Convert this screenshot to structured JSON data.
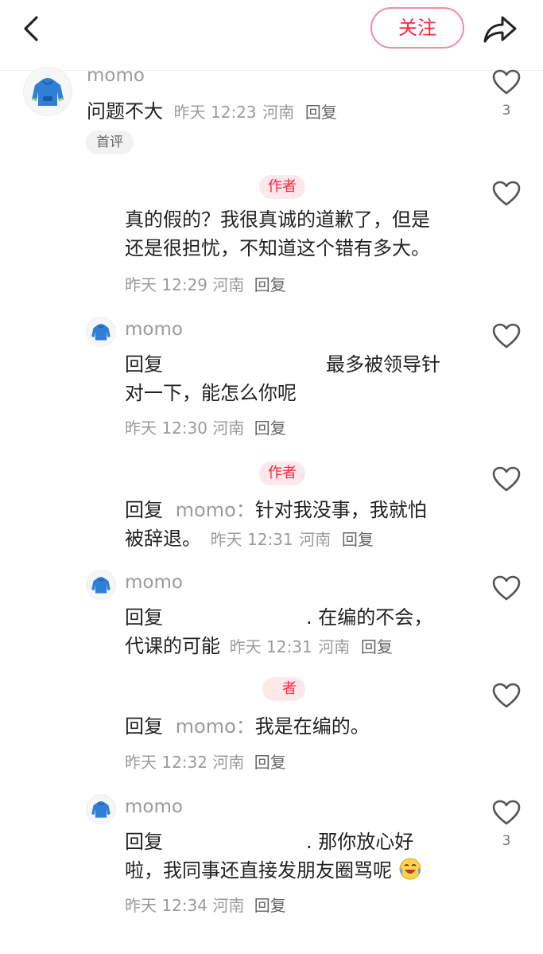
{
  "header": {
    "follow_label": "关注"
  },
  "comment": {
    "username": "momo",
    "text": "问题不大",
    "time": "昨天 12:23",
    "location": "河南",
    "reply_label": "回复",
    "first_badge": "首评",
    "like_count": "3"
  },
  "replies": [
    {
      "badge": "作者",
      "line1": "真的假的？我很真诚的道歉了，但是",
      "line2": "还是很担忧，不知道这个错有多大。",
      "time": "昨天 12:29",
      "location": "河南",
      "reply_label": "回复"
    },
    {
      "username": "momo",
      "prefix": "回复",
      "line1": "最多被领导针",
      "line2": "对一下，能怎么你呢",
      "time": "昨天 12:30",
      "location": "河南",
      "reply_label": "回复"
    },
    {
      "badge": "作者",
      "prefix": "回复",
      "reply_to": "momo：",
      "line1": "针对我没事，我就怕",
      "line2": "被辞退。",
      "time": "昨天 12:31",
      "location": "河南",
      "reply_label": "回复"
    },
    {
      "username": "momo",
      "prefix": "回复",
      "line1": ". 在编的不会，",
      "line2": "代课的可能",
      "time": "昨天 12:31",
      "location": "河南",
      "reply_label": "回复"
    },
    {
      "badge": "者",
      "prefix": "回复",
      "reply_to": "momo：",
      "line1": "我是在编的。",
      "time": "昨天 12:32",
      "location": "河南",
      "reply_label": "回复"
    },
    {
      "username": "momo",
      "prefix": "回复",
      "line1": ". 那你放心好",
      "line2": "啦，我同事还直接发朋友圈骂呢",
      "emoji": "crying-laughing-emoji",
      "time": "昨天 12:34",
      "location": "河南",
      "reply_label": "回复",
      "like_count": "3"
    }
  ],
  "colors": {
    "accent": "#ff2442",
    "meta": "#9b9b9b",
    "avatar": "#2f7fd6"
  }
}
